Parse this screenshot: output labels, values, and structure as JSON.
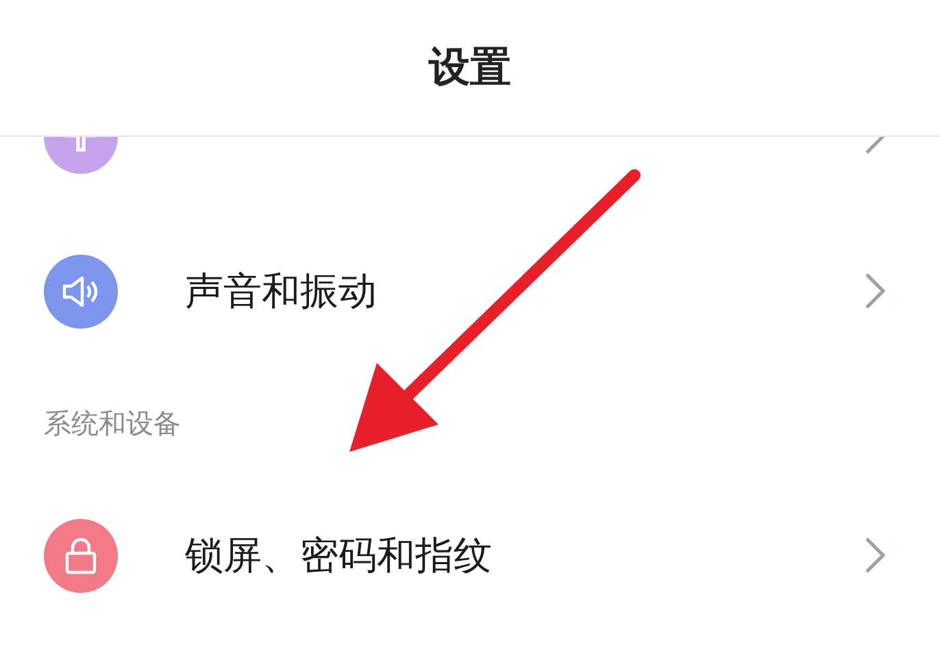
{
  "header": {
    "title": "设置"
  },
  "items": [
    {
      "kind": "theme",
      "color": "#c6a4ec"
    },
    {
      "kind": "sound",
      "color": "#7e95ec",
      "label": "声音和振动"
    },
    {
      "kind": "section",
      "label": "系统和设备"
    },
    {
      "kind": "lock",
      "color": "#f17a86",
      "label": "锁屏、密码和指纹"
    }
  ]
}
